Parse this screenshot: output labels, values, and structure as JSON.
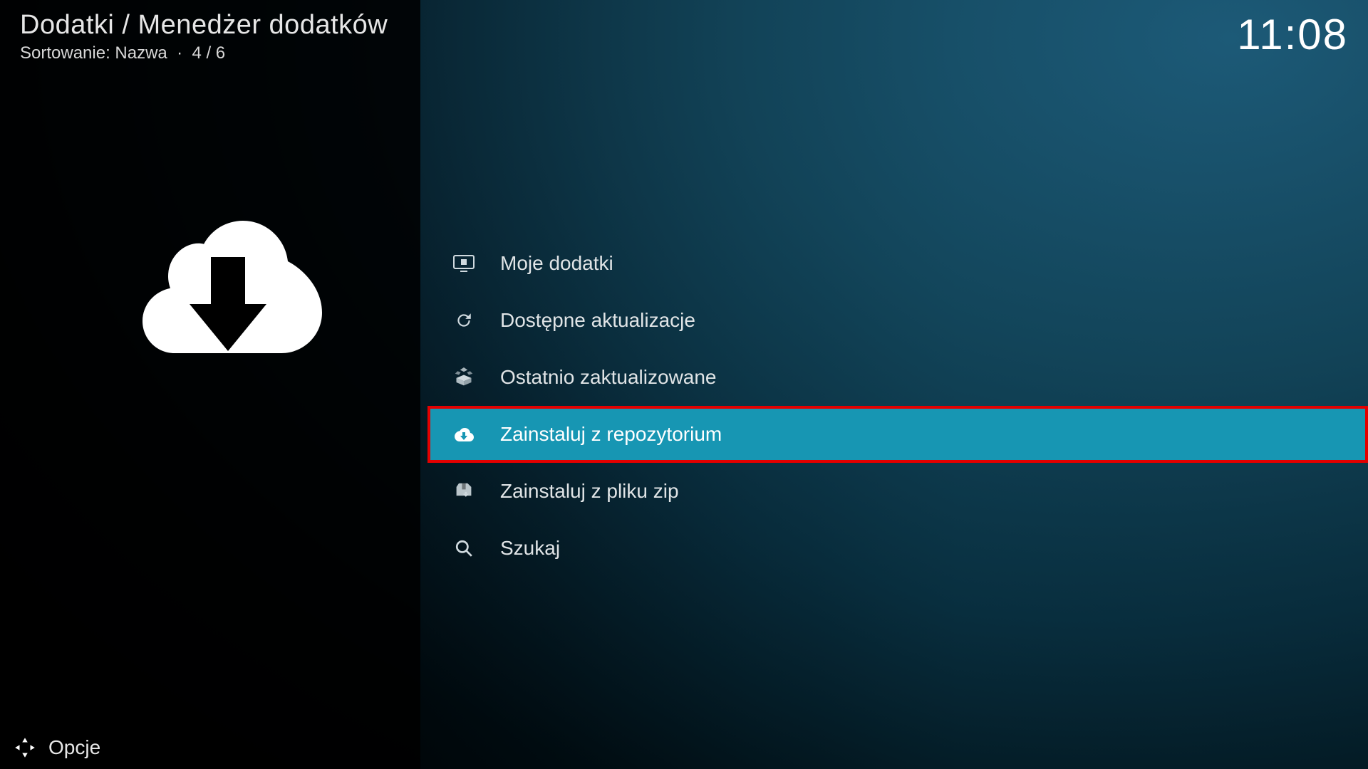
{
  "header": {
    "breadcrumb": "Dodatki / Menedżer dodatków",
    "sort_label": "Sortowanie: Nazwa",
    "position": "4 / 6",
    "clock": "11:08"
  },
  "list": {
    "items": [
      {
        "icon": "screen-box-icon",
        "label": "Moje dodatki",
        "selected": false,
        "highlight": false
      },
      {
        "icon": "refresh-icon",
        "label": "Dostępne aktualizacje",
        "selected": false,
        "highlight": false
      },
      {
        "icon": "open-box-icon",
        "label": "Ostatnio zaktualizowane",
        "selected": false,
        "highlight": false
      },
      {
        "icon": "cloud-down-icon",
        "label": "Zainstaluj z repozytorium",
        "selected": true,
        "highlight": true
      },
      {
        "icon": "package-down-icon",
        "label": "Zainstaluj z pliku zip",
        "selected": false,
        "highlight": false
      },
      {
        "icon": "search-icon",
        "label": "Szukaj",
        "selected": false,
        "highlight": false
      }
    ]
  },
  "footer": {
    "options_label": "Opcje"
  }
}
